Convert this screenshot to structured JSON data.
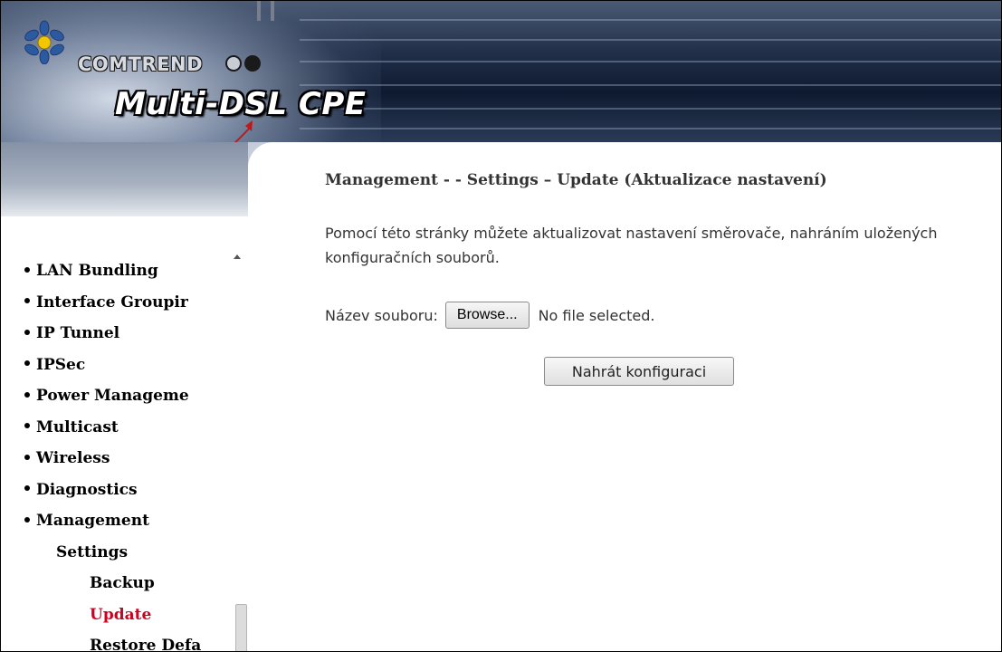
{
  "header": {
    "brand": "COMTREND",
    "product": "Multi-DSL CPE"
  },
  "sidebar": {
    "items": [
      {
        "label": "LAN Bundling",
        "level": 0,
        "bullet": true
      },
      {
        "label": "Interface Groupir",
        "level": 0,
        "bullet": true
      },
      {
        "label": "IP Tunnel",
        "level": 0,
        "bullet": true
      },
      {
        "label": "IPSec",
        "level": 0,
        "bullet": true
      },
      {
        "label": "Power Manageme",
        "level": 0,
        "bullet": true
      },
      {
        "label": "Multicast",
        "level": 0,
        "bullet": true
      },
      {
        "label": "Wireless",
        "level": 0,
        "bullet": true
      },
      {
        "label": "Diagnostics",
        "level": 0,
        "bullet": true
      },
      {
        "label": "Management",
        "level": 0,
        "bullet": true
      },
      {
        "label": "Settings",
        "level": 1,
        "bullet": false
      },
      {
        "label": "Backup",
        "level": 2,
        "bullet": false
      },
      {
        "label": "Update",
        "level": 2,
        "bullet": false,
        "active": true
      },
      {
        "label": "Restore Defa",
        "level": 2,
        "bullet": false
      }
    ],
    "active_color": "#d00020"
  },
  "main": {
    "title": "Management - - Settings – Update (Aktualizace nastavení)",
    "description": "Pomocí této stránky můžete aktualizovat nastavení směrovače, nahráním uložených konfiguračních souborů.",
    "file_label": "Název souboru:",
    "browse_label": "Browse...",
    "file_status": "No file selected.",
    "upload_label": "Nahrát konfiguraci"
  }
}
